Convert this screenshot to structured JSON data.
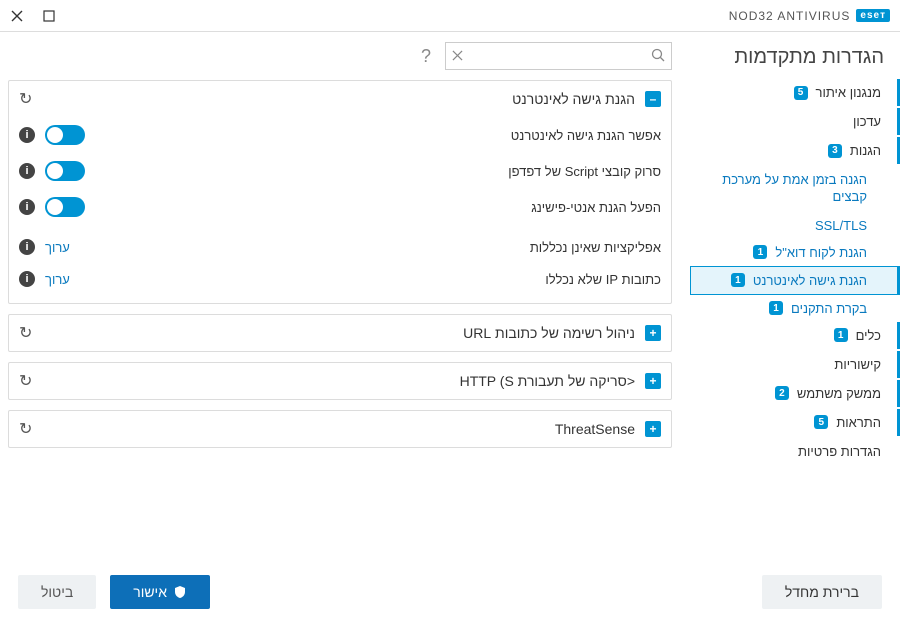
{
  "brand": {
    "badge": "eseт",
    "product": "NOD32 ANTIVIRUS"
  },
  "page_title": "הגדרות מתקדמות",
  "sidebar": {
    "items": [
      {
        "label": "מנגנון איתור",
        "badge": "5"
      },
      {
        "label": "עדכון"
      },
      {
        "label": "הגנות",
        "badge": "3"
      },
      {
        "label": "כלים",
        "badge": "1"
      },
      {
        "label": "קישוריות"
      },
      {
        "label": "ממשק משתמש",
        "badge": "2"
      },
      {
        "label": "התראות",
        "badge": "5"
      },
      {
        "label": "הגדרות פרטיות"
      }
    ],
    "subitems": [
      {
        "label": "הגנה בזמן אמת על מערכת קבצים"
      },
      {
        "label": "SSL/TLS"
      },
      {
        "label": "הגנת לקוח דוא\"ל",
        "badge": "1"
      },
      {
        "label": "הגנת גישה לאינטרנט",
        "badge": "1",
        "selected": true
      },
      {
        "label": "בקרת התקנים",
        "badge": "1"
      }
    ]
  },
  "search": {
    "placeholder": ""
  },
  "sections": {
    "web_access": {
      "title": "הגנת גישה לאינטרנט",
      "rows": [
        {
          "label": "אפשר הגנת גישה לאינטרנט",
          "type": "toggle",
          "on": true
        },
        {
          "label": "סרוק קובצי Script של דפדפן",
          "type": "toggle",
          "on": true
        },
        {
          "label": "הפעל הגנת אנטי-פישינג",
          "type": "toggle",
          "on": true
        },
        {
          "label": "אפליקציות שאינן נכללות",
          "type": "link",
          "link": "ערוך"
        },
        {
          "label": "כתובות IP שלא נכללו",
          "type": "link",
          "link": "ערוך"
        }
      ]
    },
    "url_mgmt": {
      "title": "ניהול רשימה של כתובות URL"
    },
    "http_scan": {
      "title": "<סריקה של תעבורת HTTP (S"
    },
    "threatsense": {
      "title": "ThreatSense"
    }
  },
  "footer": {
    "default": "ברירת מחדל",
    "ok": "אישור",
    "cancel": "ביטול"
  }
}
